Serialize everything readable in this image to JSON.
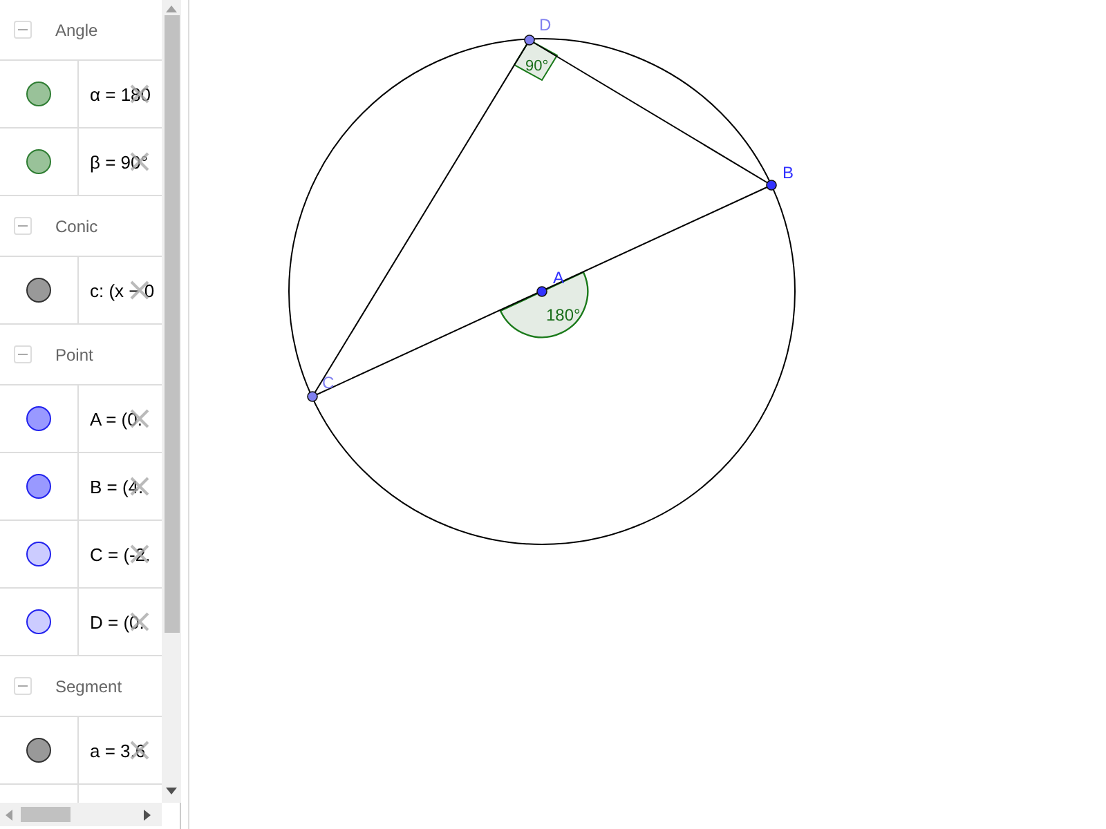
{
  "algebra": {
    "sections": [
      {
        "title": "Angle",
        "expanded": true,
        "items": [
          {
            "text": "α = 180",
            "color": "#99c299",
            "visible": true
          },
          {
            "text": "β = 90°",
            "color": "#99c299",
            "visible": true
          }
        ]
      },
      {
        "title": "Conic",
        "expanded": true,
        "items": [
          {
            "text": "c: (x − 0",
            "color": "#999999",
            "visible": true
          }
        ]
      },
      {
        "title": "Point",
        "expanded": true,
        "items": [
          {
            "text": "A = (0.",
            "color": "#9999ff",
            "visible": true
          },
          {
            "text": "B = (4.",
            "color": "#9999ff",
            "visible": true
          },
          {
            "text": "C = (-2.",
            "color": "#ccccff",
            "visible": true
          },
          {
            "text": "D = (0.",
            "color": "#ccccff",
            "visible": true
          }
        ]
      },
      {
        "title": "Segment",
        "expanded": true,
        "items": [
          {
            "text": "a = 3.6",
            "color": "#999999",
            "visible": true
          }
        ]
      }
    ]
  },
  "graphics": {
    "points": [
      {
        "label": "A",
        "color": "#3333ff"
      },
      {
        "label": "B",
        "color": "#3333ff"
      },
      {
        "label": "C",
        "color": "#8080f0"
      },
      {
        "label": "D",
        "color": "#8080f0"
      }
    ],
    "angles": [
      {
        "value": "180°"
      },
      {
        "value": "90°"
      }
    ]
  }
}
